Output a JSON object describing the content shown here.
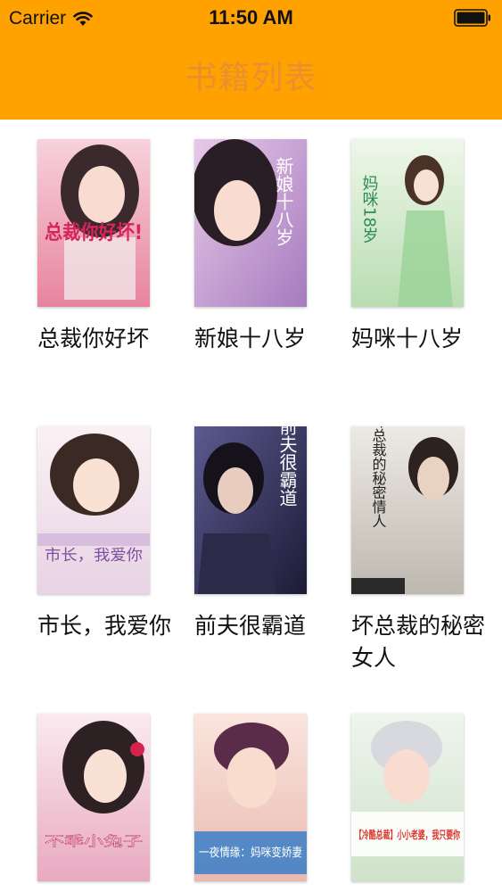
{
  "status_bar": {
    "carrier": "Carrier",
    "time": "11:50 AM",
    "wifi_icon": "wifi-icon",
    "battery_icon": "battery-full-icon"
  },
  "nav_bar": {
    "title": "书籍列表",
    "background_color": "#FFA200",
    "title_color": "#E98F2E"
  },
  "books": [
    {
      "title": "总裁你好坏",
      "cover_text": "总裁你好坏!",
      "cover_palette": [
        "#F2B8C6",
        "#E0607E"
      ]
    },
    {
      "title": "新娘十八岁",
      "cover_text": "新娘十八岁",
      "cover_palette": [
        "#D9B3DE",
        "#9B6BB0"
      ]
    },
    {
      "title": "妈咪十八岁",
      "cover_text": "妈咪18岁",
      "cover_palette": [
        "#DFF0D6",
        "#A8CFA0"
      ]
    },
    {
      "title": "市长，我爱你",
      "cover_text": "市长，我爱你",
      "cover_palette": [
        "#F3E6EE",
        "#9B6FB2"
      ]
    },
    {
      "title": "前夫很霸道",
      "cover_text": "前夫很霸道",
      "cover_palette": [
        "#3C3A66",
        "#1E1D3A"
      ]
    },
    {
      "title": "坏总裁的秘密女人",
      "cover_text": "坏总裁的秘密情人",
      "cover_palette": [
        "#DAD6CF",
        "#6E6B66"
      ]
    },
    {
      "title": "",
      "cover_text": "不乖小兔子",
      "cover_palette": [
        "#F5D9E4",
        "#C66B8E"
      ]
    },
    {
      "title": "",
      "cover_text": "一夜情缘：妈咪变娇妻",
      "cover_palette": [
        "#F4D6CE",
        "#3A7FC8"
      ]
    },
    {
      "title": "",
      "cover_text": "【冷酷总裁】小小老婆，我只要你",
      "cover_palette": [
        "#E6F0E2",
        "#D9362C"
      ]
    }
  ]
}
